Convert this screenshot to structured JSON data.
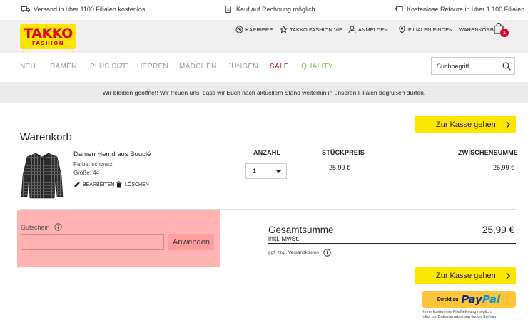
{
  "topbar": {
    "usp1": "Versand in über 1100 Filialen kostenlos",
    "usp2": "Kauf auf Rechnung möglich",
    "usp3": "Kostenlose Retoure in über 1.100 Filialen"
  },
  "logo": {
    "line1": "TAKKO",
    "line2": "FASHION"
  },
  "header": {
    "karriere": "KARRIERE",
    "vip": "TAKKO FASHION VIP",
    "anmelden": "ANMELDEN",
    "filialen": "FILIALEN FINDEN",
    "warenkorb": "WARENKORB",
    "cart_count": "1"
  },
  "nav": {
    "items": [
      "NEU",
      "DAMEN",
      "PLUS SIZE",
      "HERREN",
      "MÄDCHEN",
      "JUNGEN",
      "SALE",
      "QUALITY"
    ],
    "sale_color": "#c8102e",
    "quality_color": "#7ac143"
  },
  "search": {
    "placeholder": "Suchbegriff"
  },
  "notice": "Wir bleiben geöffnet! Wir freuen uns, dass wir Euch nach aktuellem Stand weiterhin in unseren Filialen begrüßen dürfen.",
  "checkout_label": "Zur Kasse gehen",
  "cart": {
    "title": "Warenkorb",
    "headers": {
      "qty": "ANZAHL",
      "unit": "STÜCKPREIS",
      "subtotal": "ZWISCHENSUMME"
    },
    "item": {
      "name": "Damen Hemd aus Bouclé",
      "color": "Farbe: schwarz",
      "size": "Größe: 44",
      "edit": "BEARBEITEN",
      "delete": "LÖSCHEN",
      "qty": "1",
      "unit_price": "25,99 €",
      "subtotal": "25,99 €"
    }
  },
  "voucher": {
    "label": "Gutschein",
    "apply": "Anwenden"
  },
  "totals": {
    "label": "Gesamtsumme",
    "value": "25,99 €",
    "vat": "inkl. MwSt.",
    "shipping": "ggf. zzgl. Versandkosten"
  },
  "paypal": {
    "prefix": "Direkt zu",
    "brand1": "Pay",
    "brand2": "Pal",
    "note1": "Keine kostenfreie Filiallieferung möglich.",
    "note2": "Infos zur Datenverarbeitung finden Sie",
    "note_link": "hier"
  },
  "colors": {
    "accent_yellow": "#ffe600",
    "brand_red": "#e4002b",
    "voucher_highlight": "#ffb3b3"
  }
}
